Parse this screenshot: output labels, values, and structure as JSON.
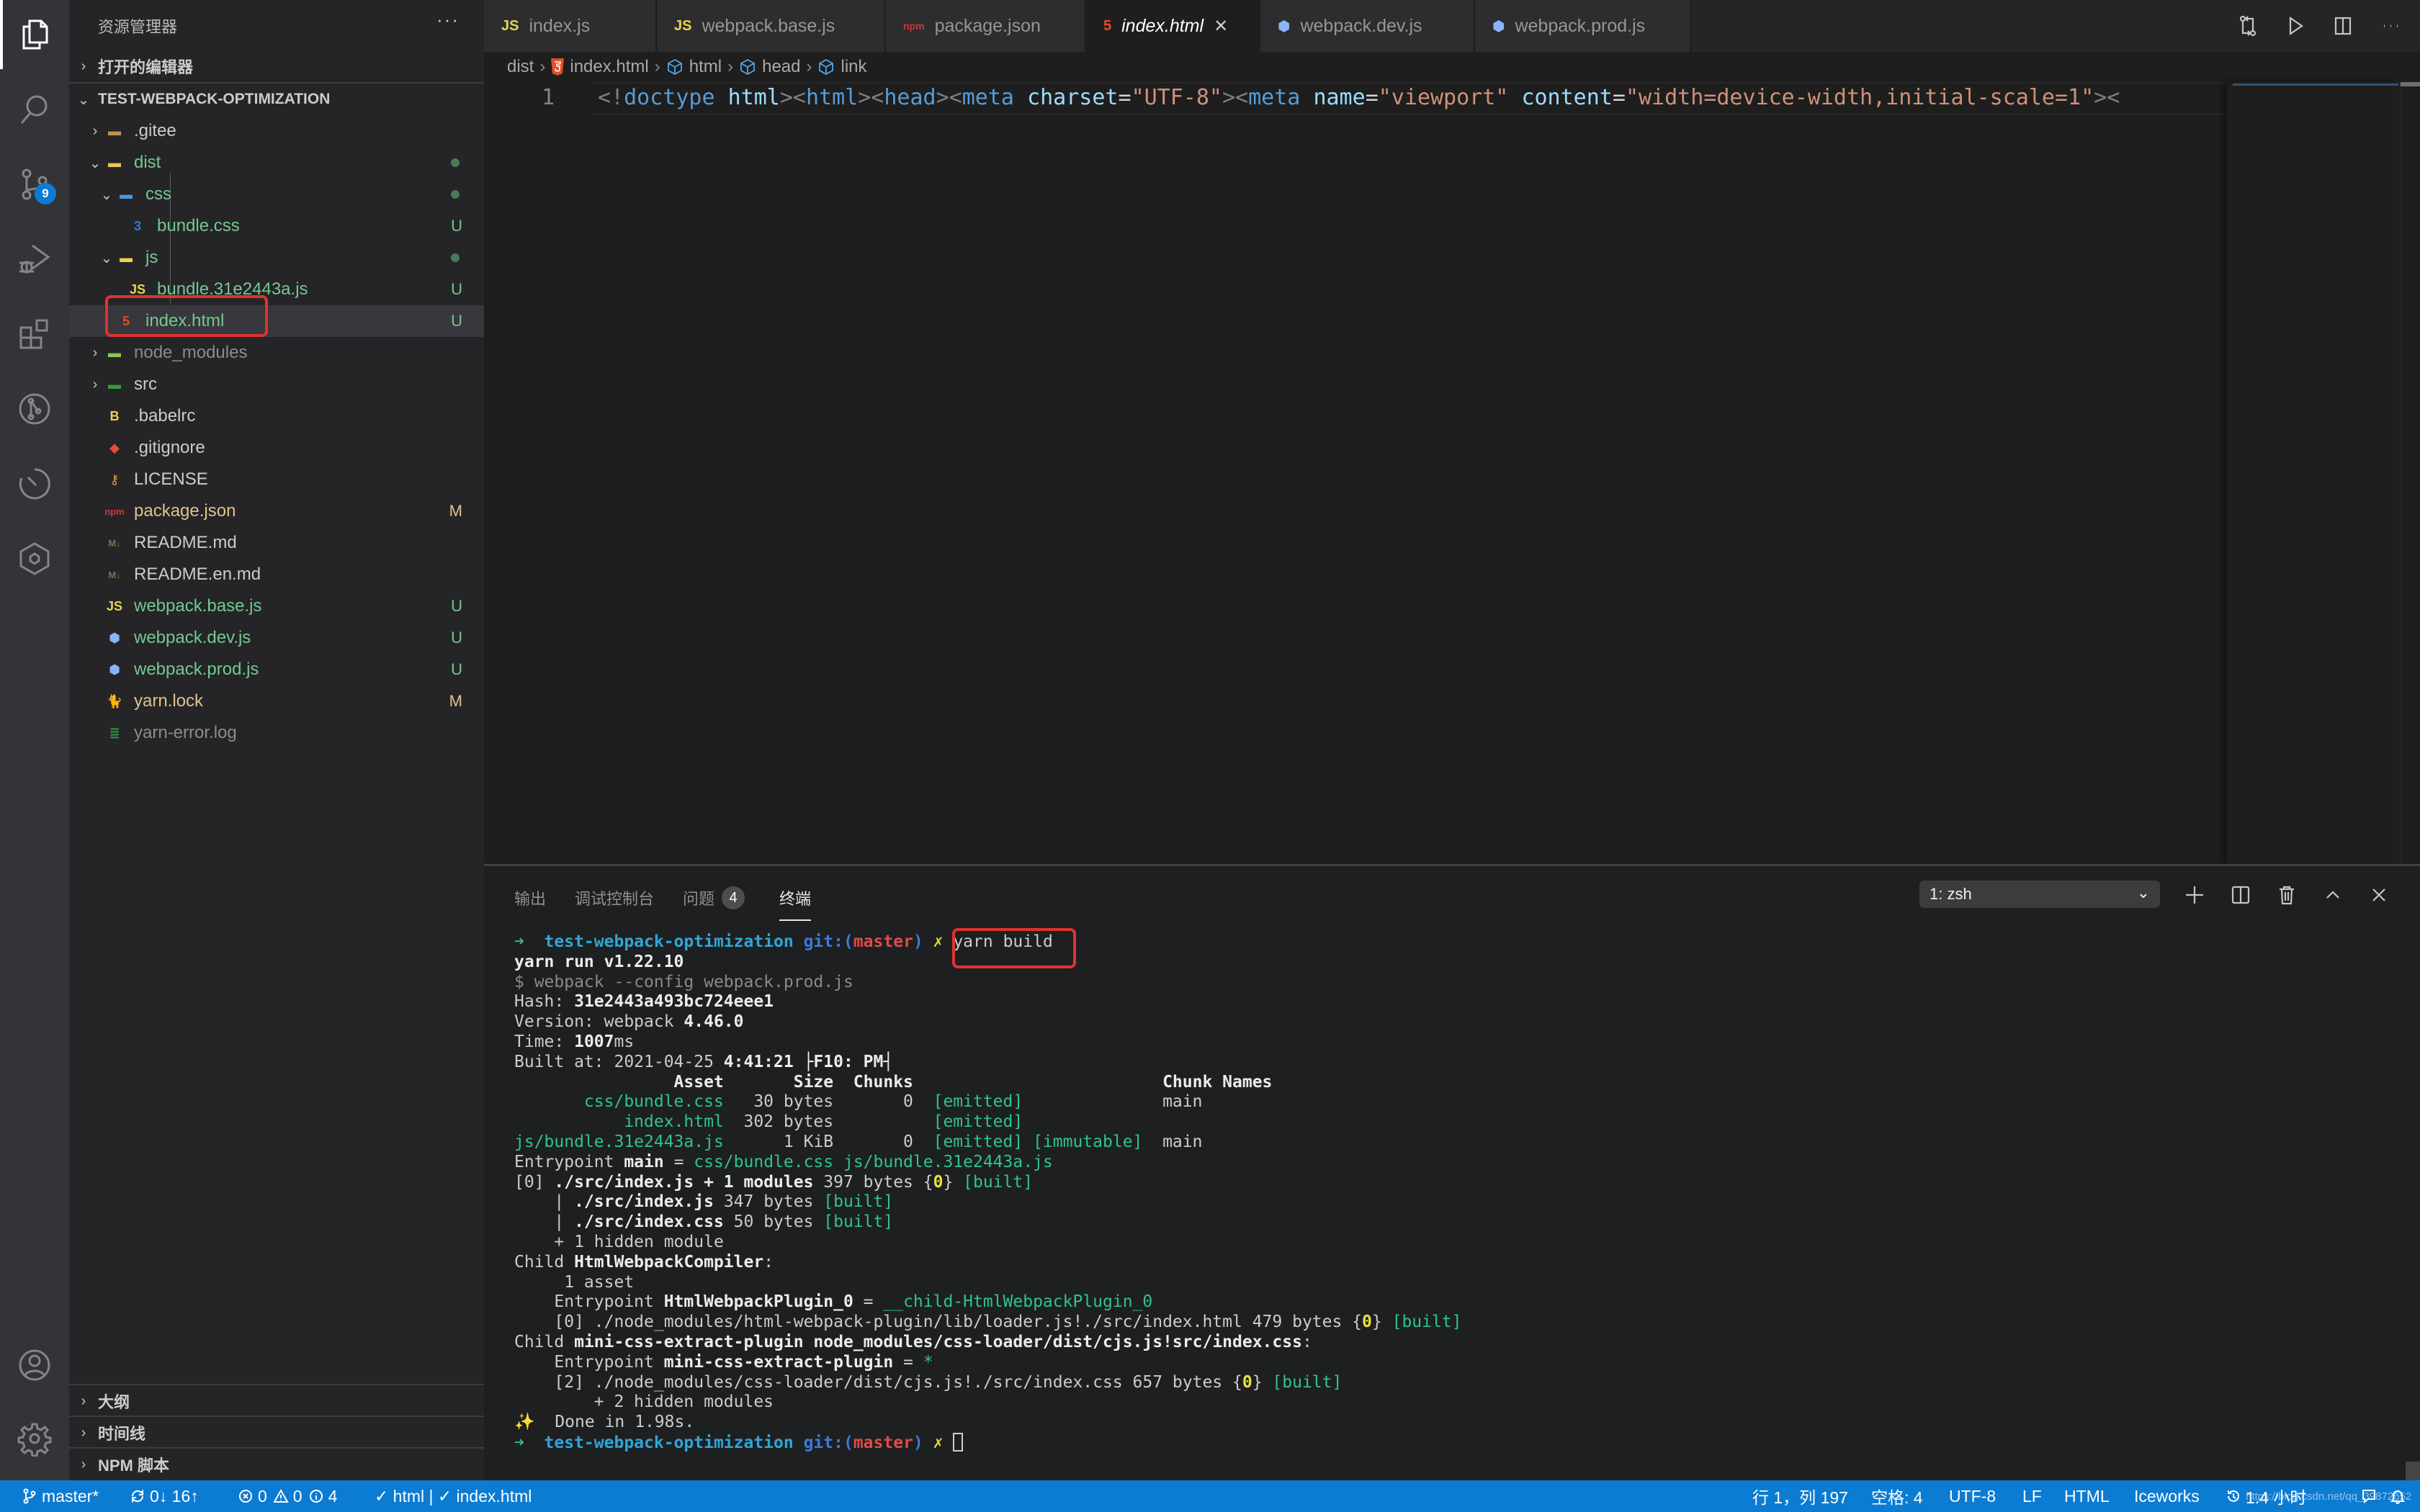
{
  "activity_bar": {
    "items": [
      {
        "name": "explorer",
        "icon": "files-icon",
        "active": true
      },
      {
        "name": "search",
        "icon": "search-icon"
      },
      {
        "name": "source-control",
        "icon": "source-control-icon",
        "badge": "9"
      },
      {
        "name": "run-debug",
        "icon": "debug-icon"
      },
      {
        "name": "extensions",
        "icon": "extensions-icon"
      },
      {
        "name": "git-graph",
        "icon": "git-graph-icon"
      },
      {
        "name": "timeline",
        "icon": "timer-icon"
      },
      {
        "name": "iceworks",
        "icon": "iceworks-icon"
      }
    ],
    "bottom": [
      {
        "name": "accounts",
        "icon": "account-icon"
      },
      {
        "name": "manage",
        "icon": "gear-icon"
      }
    ]
  },
  "sidebar": {
    "title": "资源管理器",
    "more": "···",
    "open_editors": "打开的编辑器",
    "project": "TEST-WEBPACK-OPTIMIZATION",
    "tree": [
      {
        "label": ".gitee",
        "type": "folder",
        "expanded": false,
        "depth": 1,
        "color": "plain",
        "icon": "folder-icon"
      },
      {
        "label": "dist",
        "type": "folder",
        "expanded": true,
        "depth": 1,
        "color": "green",
        "icon": "dist-folder-icon",
        "status": "dot"
      },
      {
        "label": "css",
        "type": "folder",
        "expanded": true,
        "depth": 2,
        "color": "green",
        "icon": "css-folder-icon",
        "status": "dot"
      },
      {
        "label": "bundle.css",
        "type": "file",
        "depth": 3,
        "color": "green",
        "icon": "css3-icon",
        "status": "U"
      },
      {
        "label": "js",
        "type": "folder",
        "expanded": true,
        "depth": 2,
        "color": "green",
        "icon": "js-folder-icon",
        "status": "dot"
      },
      {
        "label": "bundle.31e2443a.js",
        "type": "file",
        "depth": 3,
        "color": "green",
        "icon": "js-icon",
        "status": "U"
      },
      {
        "label": "index.html",
        "type": "file",
        "depth": 2,
        "color": "green",
        "icon": "html5-icon",
        "status": "U",
        "selected": true
      },
      {
        "label": "node_modules",
        "type": "folder",
        "expanded": false,
        "depth": 1,
        "color": "dim",
        "icon": "node-folder-icon"
      },
      {
        "label": "src",
        "type": "folder",
        "expanded": false,
        "depth": 1,
        "color": "plain",
        "icon": "src-folder-icon"
      },
      {
        "label": ".babelrc",
        "type": "file",
        "depth": 1,
        "color": "plain",
        "icon": "babel-icon"
      },
      {
        "label": ".gitignore",
        "type": "file",
        "depth": 1,
        "color": "plain",
        "icon": "git-icon"
      },
      {
        "label": "LICENSE",
        "type": "file",
        "depth": 1,
        "color": "plain",
        "icon": "license-icon"
      },
      {
        "label": "package.json",
        "type": "file",
        "depth": 1,
        "color": "mod",
        "icon": "npm-icon",
        "status": "M"
      },
      {
        "label": "README.md",
        "type": "file",
        "depth": 1,
        "color": "plain",
        "icon": "markdown-icon"
      },
      {
        "label": "README.en.md",
        "type": "file",
        "depth": 1,
        "color": "plain",
        "icon": "markdown-icon"
      },
      {
        "label": "webpack.base.js",
        "type": "file",
        "depth": 1,
        "color": "green",
        "icon": "js-icon",
        "status": "U"
      },
      {
        "label": "webpack.dev.js",
        "type": "file",
        "depth": 1,
        "color": "green",
        "icon": "webpack-icon",
        "status": "U"
      },
      {
        "label": "webpack.prod.js",
        "type": "file",
        "depth": 1,
        "color": "green",
        "icon": "webpack-icon",
        "status": "U"
      },
      {
        "label": "yarn.lock",
        "type": "file",
        "depth": 1,
        "color": "mod",
        "icon": "yarn-icon",
        "status": "M"
      },
      {
        "label": "yarn-error.log",
        "type": "file",
        "depth": 1,
        "color": "dim",
        "icon": "log-icon"
      }
    ],
    "bottom_sections": [
      "大纲",
      "时间线",
      "NPM 脚本"
    ]
  },
  "editor": {
    "tabs": [
      {
        "label": "index.js",
        "icon": "JS",
        "icon_color": "#e8d44d"
      },
      {
        "label": "webpack.base.js",
        "icon": "JS",
        "icon_color": "#e8d44d"
      },
      {
        "label": "package.json",
        "icon": "npm",
        "icon_color": "#cb3837"
      },
      {
        "label": "index.html",
        "icon": "5",
        "icon_color": "#e44d26",
        "active": true
      },
      {
        "label": "webpack.dev.js",
        "icon": "⬢",
        "icon_color": "#8ab4f8"
      },
      {
        "label": "webpack.prod.js",
        "icon": "⬢",
        "icon_color": "#8ab4f8"
      }
    ],
    "close_glyph": "✕",
    "breadcrumb": [
      "dist",
      "index.html",
      "html",
      "head",
      "link"
    ],
    "line_number": "1",
    "code_tokens": [
      {
        "t": "<!",
        "c": "punc"
      },
      {
        "t": "doctype",
        "c": "tag"
      },
      {
        "t": " ",
        "c": "eq"
      },
      {
        "t": "html",
        "c": "attr"
      },
      {
        "t": "><",
        "c": "punc"
      },
      {
        "t": "html",
        "c": "tag"
      },
      {
        "t": "><",
        "c": "punc"
      },
      {
        "t": "head",
        "c": "tag"
      },
      {
        "t": "><",
        "c": "punc"
      },
      {
        "t": "meta",
        "c": "tag"
      },
      {
        "t": " ",
        "c": "eq"
      },
      {
        "t": "charset",
        "c": "attr"
      },
      {
        "t": "=",
        "c": "eq"
      },
      {
        "t": "\"UTF-8\"",
        "c": "str"
      },
      {
        "t": "><",
        "c": "punc"
      },
      {
        "t": "meta",
        "c": "tag"
      },
      {
        "t": " ",
        "c": "eq"
      },
      {
        "t": "name",
        "c": "attr"
      },
      {
        "t": "=",
        "c": "eq"
      },
      {
        "t": "\"viewport\"",
        "c": "str"
      },
      {
        "t": " ",
        "c": "eq"
      },
      {
        "t": "content",
        "c": "attr"
      },
      {
        "t": "=",
        "c": "eq"
      },
      {
        "t": "\"width=device-width,initial-scale=1\"",
        "c": "str"
      },
      {
        "t": "><",
        "c": "punc"
      }
    ]
  },
  "panel": {
    "tabs": [
      {
        "label": "输出"
      },
      {
        "label": "调试控制台"
      },
      {
        "label": "问题",
        "badge": "4"
      },
      {
        "label": "终端",
        "active": true
      }
    ],
    "terminal_select": "1: zsh",
    "terminal_lines": [
      [
        {
          "t": "➜  ",
          "c": "arrow"
        },
        {
          "t": "test-webpack-optimization ",
          "c": "dir"
        },
        {
          "t": "git:(",
          "c": "git"
        },
        {
          "t": "master",
          "c": "br"
        },
        {
          "t": ") ",
          "c": "git"
        },
        {
          "t": "✗ ",
          "c": "x"
        },
        {
          "t": "yarn build",
          "c": "plain",
          "boxed": true
        }
      ],
      [
        {
          "t": "yarn run v1.22.10",
          "c": "b"
        }
      ],
      [
        {
          "t": "$ webpack --config webpack.prod.js",
          "c": "dim"
        }
      ],
      [
        {
          "t": "Hash: ",
          "c": "plain"
        },
        {
          "t": "31e2443a493bc724eee1",
          "c": "b"
        }
      ],
      [
        {
          "t": "Version: webpack ",
          "c": "plain"
        },
        {
          "t": "4.46.0",
          "c": "b"
        }
      ],
      [
        {
          "t": "Time: ",
          "c": "plain"
        },
        {
          "t": "1007",
          "c": "b"
        },
        {
          "t": "ms",
          "c": "plain"
        }
      ],
      [
        {
          "t": "Built at: 2021-04-25 ",
          "c": "plain"
        },
        {
          "t": "4:41:21 ├F10: PM┤",
          "c": "b"
        }
      ],
      [
        {
          "t": "                Asset       Size  Chunks                         Chunk Names",
          "c": "b"
        }
      ],
      [
        {
          "t": "       css/bundle.css",
          "c": "g"
        },
        {
          "t": "   30 bytes       0  ",
          "c": "plain"
        },
        {
          "t": "[emitted]",
          "c": "g"
        },
        {
          "t": "              main",
          "c": "plain"
        }
      ],
      [
        {
          "t": "           index.html",
          "c": "g"
        },
        {
          "t": "  302 bytes          ",
          "c": "plain"
        },
        {
          "t": "[emitted]",
          "c": "g"
        }
      ],
      [
        {
          "t": "js/bundle.31e2443a.js",
          "c": "g"
        },
        {
          "t": "      1 KiB       0  ",
          "c": "plain"
        },
        {
          "t": "[emitted] [immutable]",
          "c": "g"
        },
        {
          "t": "  main",
          "c": "plain"
        }
      ],
      [
        {
          "t": "Entrypoint ",
          "c": "plain"
        },
        {
          "t": "main",
          "c": "b"
        },
        {
          "t": " = ",
          "c": "plain"
        },
        {
          "t": "css/bundle.css js/bundle.31e2443a.js",
          "c": "g"
        }
      ],
      [
        {
          "t": "[0] ",
          "c": "plain"
        },
        {
          "t": "./src/index.js + 1 modules",
          "c": "b"
        },
        {
          "t": " 397 bytes {",
          "c": "plain"
        },
        {
          "t": "0",
          "c": "y"
        },
        {
          "t": "} ",
          "c": "plain"
        },
        {
          "t": "[built]",
          "c": "g"
        }
      ],
      [
        {
          "t": "    | ",
          "c": "plain"
        },
        {
          "t": "./src/index.js",
          "c": "b"
        },
        {
          "t": " 347 bytes ",
          "c": "plain"
        },
        {
          "t": "[built]",
          "c": "g"
        }
      ],
      [
        {
          "t": "    | ",
          "c": "plain"
        },
        {
          "t": "./src/index.css",
          "c": "b"
        },
        {
          "t": " 50 bytes ",
          "c": "plain"
        },
        {
          "t": "[built]",
          "c": "g"
        }
      ],
      [
        {
          "t": "    + 1 hidden module",
          "c": "plain"
        }
      ],
      [
        {
          "t": "Child ",
          "c": "plain"
        },
        {
          "t": "HtmlWebpackCompiler",
          "c": "b"
        },
        {
          "t": ":",
          "c": "plain"
        }
      ],
      [
        {
          "t": "     1 asset",
          "c": "plain"
        }
      ],
      [
        {
          "t": "    Entrypoint ",
          "c": "plain"
        },
        {
          "t": "HtmlWebpackPlugin_0",
          "c": "b"
        },
        {
          "t": " = ",
          "c": "plain"
        },
        {
          "t": "__child-HtmlWebpackPlugin_0",
          "c": "g"
        }
      ],
      [
        {
          "t": "    [0] ",
          "c": "plain"
        },
        {
          "t": "./node_modules/html-webpack-plugin/lib/loader.js!./src/index.html",
          "c": "plain"
        },
        {
          "t": " 479 bytes {",
          "c": "plain"
        },
        {
          "t": "0",
          "c": "y"
        },
        {
          "t": "} ",
          "c": "plain"
        },
        {
          "t": "[built]",
          "c": "g"
        }
      ],
      [
        {
          "t": "Child ",
          "c": "plain"
        },
        {
          "t": "mini-css-extract-plugin node_modules/css-loader/dist/cjs.js!src/index.css",
          "c": "b"
        },
        {
          "t": ":",
          "c": "plain"
        }
      ],
      [
        {
          "t": "    Entrypoint ",
          "c": "plain"
        },
        {
          "t": "mini-css-extract-plugin",
          "c": "b"
        },
        {
          "t": " = ",
          "c": "plain"
        },
        {
          "t": "*",
          "c": "g"
        }
      ],
      [
        {
          "t": "    [2] ",
          "c": "plain"
        },
        {
          "t": "./node_modules/css-loader/dist/cjs.js!./src/index.css",
          "c": "plain"
        },
        {
          "t": " 657 bytes {",
          "c": "plain"
        },
        {
          "t": "0",
          "c": "y"
        },
        {
          "t": "} ",
          "c": "plain"
        },
        {
          "t": "[built]",
          "c": "g"
        }
      ],
      [
        {
          "t": "        + 2 hidden modules",
          "c": "plain"
        }
      ],
      [
        {
          "t": "✨",
          "c": "star"
        },
        {
          "t": "  Done in 1.98s.",
          "c": "plain"
        }
      ],
      [
        {
          "t": "➜  ",
          "c": "arrow"
        },
        {
          "t": "test-webpack-optimization ",
          "c": "dir"
        },
        {
          "t": "git:(",
          "c": "git"
        },
        {
          "t": "master",
          "c": "br"
        },
        {
          "t": ") ",
          "c": "git"
        },
        {
          "t": "✗ ",
          "c": "x"
        },
        {
          "cursor": true
        }
      ]
    ]
  },
  "statusbar": {
    "branch": "master*",
    "sync": "0↓ 16↑",
    "errors": "0",
    "warnings": "0",
    "infos": "4",
    "lint": "✓ html | ✓ index.html",
    "position": "行 1，列 197",
    "indent": "空格: 4",
    "encoding": "UTF-8",
    "eol": "LF",
    "language": "HTML",
    "iceworks": "Iceworks",
    "time": "1.4 小时",
    "watermark": "https://blog.csdn.net/qq_39872652"
  },
  "colors": {
    "accent": "#0c7bd2",
    "git_untracked": "#73c991",
    "git_modified": "#e2c08d",
    "highlight_box": "#e0332e"
  }
}
